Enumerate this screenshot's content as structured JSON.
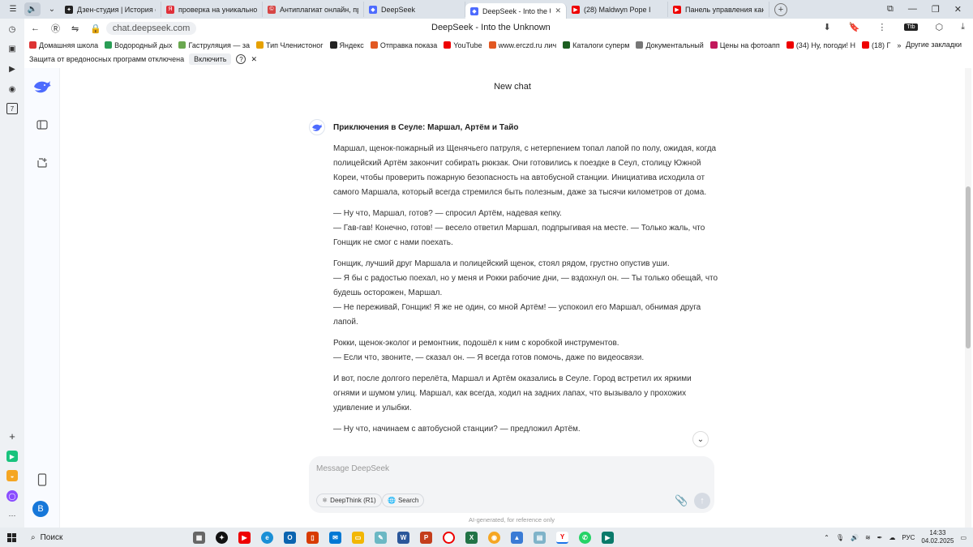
{
  "browser": {
    "tabs": [
      {
        "title": "Дзен-студия | История от",
        "color": "#222",
        "glyph": "✦",
        "active": false
      },
      {
        "title": "проверка на уникальност",
        "color": "#e0303a",
        "glyph": "Я",
        "active": false
      },
      {
        "title": "Антиплагиат онлайн, про",
        "color": "#d64545",
        "glyph": "©",
        "active": false
      },
      {
        "title": "DeepSeek",
        "color": "#4d6bfe",
        "glyph": "◆",
        "active": false
      },
      {
        "title": "DeepSeek - Into the Unk",
        "color": "#4d6bfe",
        "glyph": "◆",
        "active": true
      },
      {
        "title": "(28) Maldwyn Pope I",
        "color": "#e00",
        "glyph": "▶",
        "active": false
      },
      {
        "title": "Панель управления кана",
        "color": "#e00",
        "glyph": "▶",
        "active": false
      }
    ],
    "url": "chat.deepseek.com",
    "page_title": "DeepSeek - Into the Unknown",
    "bookmarks": [
      {
        "label": "Домашняя школа",
        "color": "#d33"
      },
      {
        "label": "Водородный дых",
        "color": "#2a9d55"
      },
      {
        "label": "Гаструляция — за",
        "color": "#6aa84f"
      },
      {
        "label": "Тип Членистоног",
        "color": "#e6a100"
      },
      {
        "label": "Яндекс",
        "color": "#222"
      },
      {
        "label": "Отправка показа",
        "color": "#e25822"
      },
      {
        "label": "YouTube",
        "color": "#e00"
      },
      {
        "label": "www.erczd.ru лич",
        "color": "#e25822"
      },
      {
        "label": "Каталоги суперм",
        "color": "#1b5e20"
      },
      {
        "label": "Документальный",
        "color": "#777"
      },
      {
        "label": "Цены на фотоапп",
        "color": "#c2185b"
      },
      {
        "label": "(34) Ну, погоди! Н",
        "color": "#e00"
      },
      {
        "label": "(18) Г",
        "color": "#e00"
      }
    ],
    "other_bookmarks": "Другие закладки",
    "warning": {
      "text": "Защита от вредоносных программ отключена",
      "button": "Включить",
      "help": "?"
    }
  },
  "chat": {
    "header_title": "New chat",
    "conversation_title": "Приключения в Сеуле: Маршал, Артём и Тайо",
    "paragraphs": [
      "Маршал, щенок-пожарный из Щенячьего патруля, с нетерпением топал лапой по полу, ожидая, когда полицейский Артём закончит собирать рюкзак. Они готовились к поездке в Сеул, столицу Южной Кореи, чтобы проверить пожарную безопасность на автобусной станции. Инициатива исходила от самого Маршала, который всегда стремился быть полезным, даже за тысячи километров от дома.",
      "— Ну что, Маршал, готов? — спросил Артём, надевая кепку.\n— Гав-гав! Конечно, готов! — весело ответил Маршал, подпрыгивая на месте. — Только жаль, что Гонщик не смог с нами поехать.",
      "Гонщик, лучший друг Маршала и полицейский щенок, стоял рядом, грустно опустив уши.\n— Я бы с радостью поехал, но у меня и Рокки рабочие дни, — вздохнул он. — Ты только обещай, что будешь осторожен, Маршал.\n— Не переживай, Гонщик! Я же не один, со мной Артём! — успокоил его Маршал, обнимая друга лапой.",
      "Рокки, щенок-эколог и ремонтник, подошёл к ним с коробкой инструментов.\n— Если что, звоните, — сказал он. — Я всегда готов помочь, даже по видеосвязи.",
      "И вот, после долгого перелёта, Маршал и Артём оказались в Сеуле. Город встретил их яркими огнями и шумом улиц. Маршал, как всегда, ходил на задних лапах, что вызывало у прохожих удивление и улыбки.",
      "— Ну что, начинаем с автобусной станции? — предложил Артём."
    ],
    "composer": {
      "placeholder": "Message DeepSeek",
      "deepthink": "DeepThink (R1)",
      "search": "Search"
    },
    "disclaimer": "AI-generated, for reference only",
    "avatar_letter": "B"
  },
  "taskbar": {
    "search": "Поиск",
    "lang": "РУС",
    "time": "14:33",
    "date": "04.02.2025"
  }
}
